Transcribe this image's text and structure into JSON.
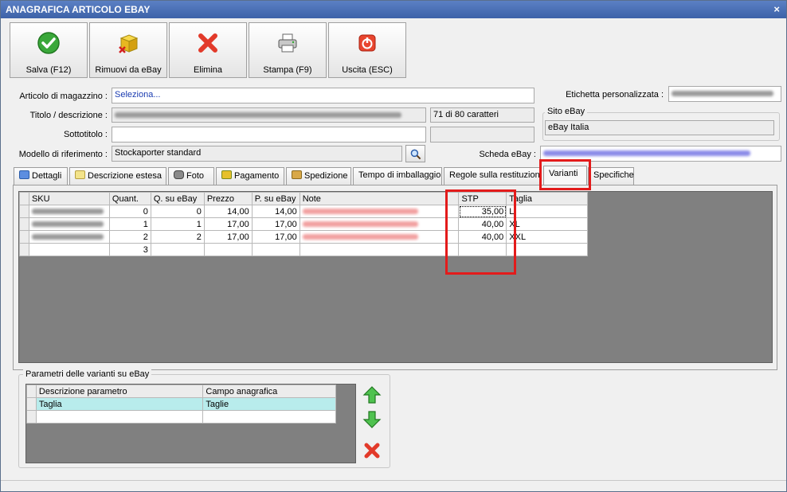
{
  "window": {
    "title": "ANAGRAFICA ARTICOLO EBAY",
    "close_glyph": "×"
  },
  "toolbar": [
    {
      "label": "Salva (F12)",
      "icon": "check-icon"
    },
    {
      "label": "Rimuovi da eBay",
      "icon": "package-remove-icon"
    },
    {
      "label": "Elimina",
      "icon": "red-x-icon"
    },
    {
      "label": "Stampa (F9)",
      "icon": "printer-icon"
    },
    {
      "label": "Uscita (ESC)",
      "icon": "power-icon"
    }
  ],
  "form": {
    "articolo_label": "Articolo di magazzino :",
    "articolo_value": "Seleziona...",
    "titolo_label": "Titolo / descrizione :",
    "titolo_counter": "71 di 80 caratteri",
    "sottotitolo_label": "Sottotitolo :",
    "modello_label": "Modello di riferimento :",
    "modello_value": "Stockaporter standard",
    "etichetta_label": "Etichetta personalizzata :",
    "sito_group": "Sito eBay",
    "sito_value": "eBay Italia",
    "scheda_label": "Scheda eBay :"
  },
  "tabs": [
    {
      "label": "Dettagli",
      "icon": "calendar-icon"
    },
    {
      "label": "Descrizione estesa",
      "icon": "notes-icon"
    },
    {
      "label": "Foto",
      "icon": "camera-icon"
    },
    {
      "label": "Pagamento",
      "icon": "payment-icon"
    },
    {
      "label": "Spedizione",
      "icon": "shipping-icon"
    },
    {
      "label": "Tempo di imballaggio",
      "icon": ""
    },
    {
      "label": "Regole sulla restituzione",
      "icon": ""
    },
    {
      "label": "Varianti",
      "icon": "",
      "active": true
    },
    {
      "label": "Specifiche",
      "icon": ""
    }
  ],
  "variants": {
    "headers": [
      "SKU",
      "Quant.",
      "Q. su eBay",
      "Prezzo",
      "P. su eBay",
      "Note",
      "STP",
      "Taglia"
    ],
    "rows": [
      {
        "quant": "0",
        "q_ebay": "0",
        "prezzo": "14,00",
        "p_ebay": "14,00",
        "stp": "35,00",
        "taglia": "L"
      },
      {
        "quant": "1",
        "q_ebay": "1",
        "prezzo": "17,00",
        "p_ebay": "17,00",
        "stp": "40,00",
        "taglia": "XL"
      },
      {
        "quant": "2",
        "q_ebay": "2",
        "prezzo": "17,00",
        "p_ebay": "17,00",
        "stp": "40,00",
        "taglia": "XXL"
      }
    ],
    "total_quant": "3"
  },
  "params": {
    "group_title": "Parametri delle varianti su eBay",
    "headers": [
      "Descrizione parametro",
      "Campo anagrafica"
    ],
    "rows": [
      {
        "descrizione": "Taglia",
        "campo": "Taglie"
      }
    ]
  },
  "colors": {
    "highlight": "#e31b1b",
    "selected_row": "#b8ecec"
  }
}
